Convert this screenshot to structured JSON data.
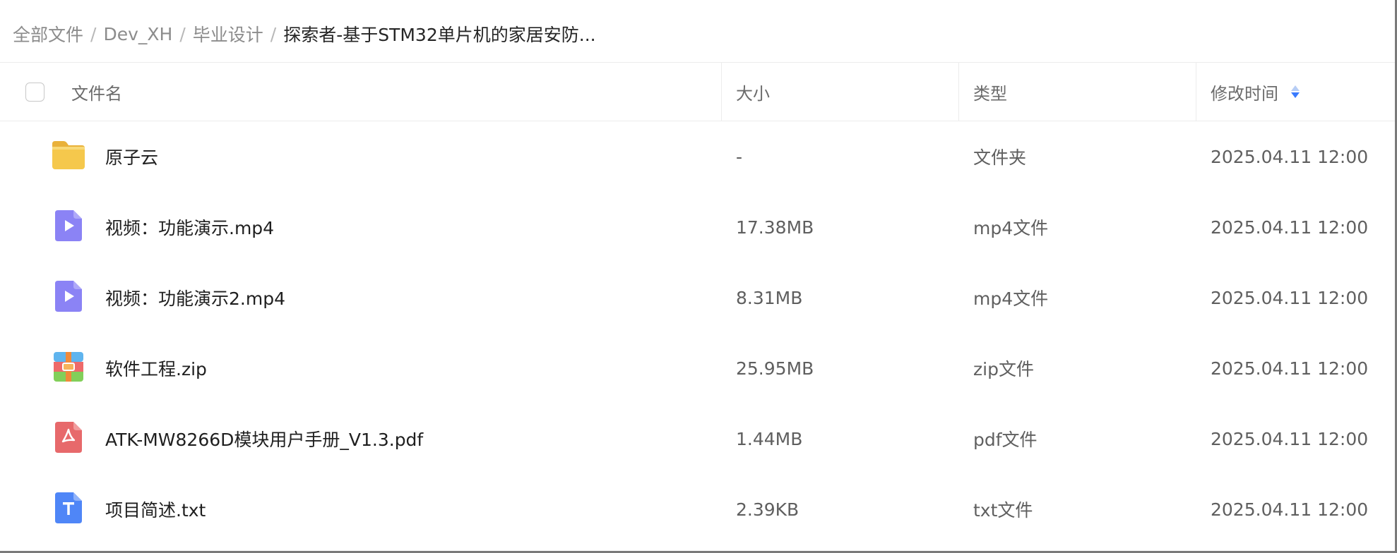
{
  "breadcrumb": {
    "items": [
      "全部文件",
      "Dev_XH",
      "毕业设计"
    ],
    "current": "探索者-基于STM32单片机的家居安防...",
    "separator": "/"
  },
  "table": {
    "columns": {
      "name": "文件名",
      "size": "大小",
      "type": "类型",
      "modified": "修改时间"
    },
    "sort_column": "modified",
    "rows": [
      {
        "icon": "folder-icon",
        "name": "原子云",
        "size": "-",
        "type": "文件夹",
        "modified": "2025.04.11 12:00"
      },
      {
        "icon": "video-file-icon",
        "name": "视频：功能演示.mp4",
        "size": "17.38MB",
        "type": "mp4文件",
        "modified": "2025.04.11 12:00"
      },
      {
        "icon": "video-file-icon",
        "name": "视频：功能演示2.mp4",
        "size": "8.31MB",
        "type": "mp4文件",
        "modified": "2025.04.11 12:00"
      },
      {
        "icon": "zip-file-icon",
        "name": "软件工程.zip",
        "size": "25.95MB",
        "type": "zip文件",
        "modified": "2025.04.11 12:00"
      },
      {
        "icon": "pdf-file-icon",
        "name": "ATK-MW8266D模块用户手册_V1.3.pdf",
        "size": "1.44MB",
        "type": "pdf文件",
        "modified": "2025.04.11 12:00"
      },
      {
        "icon": "txt-file-icon",
        "name": "项目简述.txt",
        "size": "2.39KB",
        "type": "txt文件",
        "modified": "2025.04.11 12:00"
      }
    ]
  },
  "colors": {
    "folder": "#f5c84c",
    "video": "#8b83f5",
    "pdf": "#e7696b",
    "txt": "#4f86f7",
    "sort_active": "#3a7afe",
    "header_text": "#6b6b6b",
    "breadcrumb_muted": "#8c8c8c"
  }
}
